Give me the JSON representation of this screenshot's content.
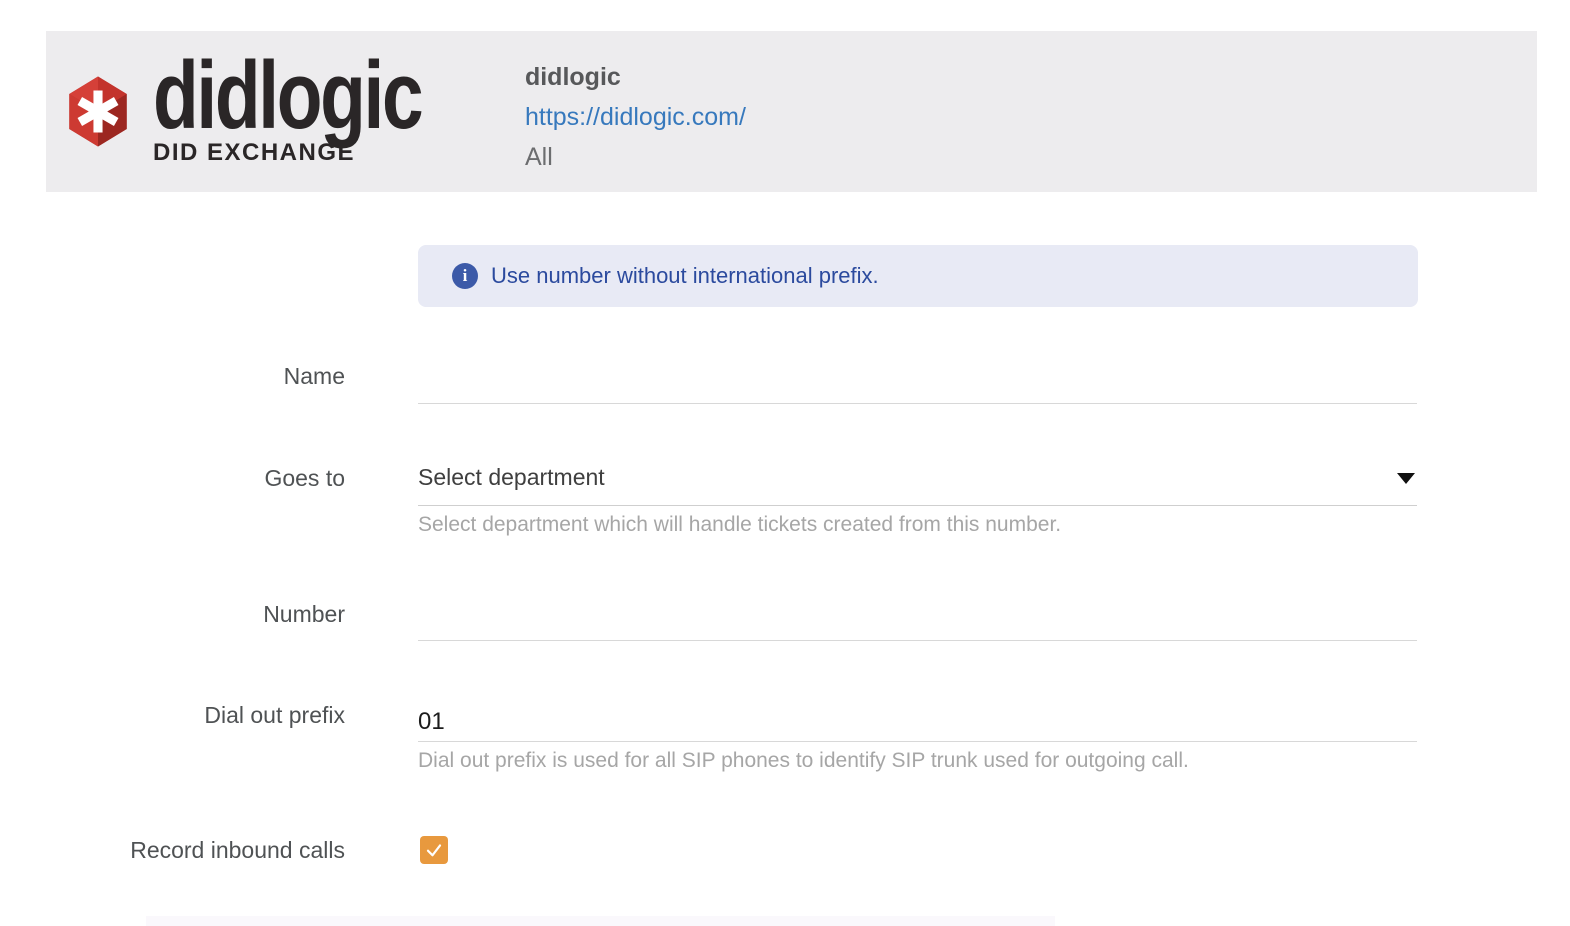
{
  "header": {
    "logo": {
      "wordmark": "didlogic",
      "tagline": "DID EXCHANGE"
    },
    "site": {
      "name": "didlogic",
      "url": "https://didlogic.com/",
      "scope": "All"
    }
  },
  "banner": {
    "icon": "info-icon",
    "icon_glyph": "i",
    "text": "Use number without international prefix."
  },
  "form": {
    "name": {
      "label": "Name",
      "value": ""
    },
    "goes_to": {
      "label": "Goes to",
      "value": "Select department",
      "helper": "Select department which will handle tickets created from this number."
    },
    "number": {
      "label": "Number",
      "value": ""
    },
    "dial_out_prefix": {
      "label": "Dial out prefix",
      "value": "01",
      "helper": "Dial out prefix is used for all SIP phones to identify SIP trunk used for outgoing call."
    },
    "record_inbound_calls": {
      "label": "Record inbound calls",
      "checked": true
    }
  },
  "colors": {
    "header_bg": "#edecee",
    "brand_red": "#cd3a32",
    "link_blue": "#3779bd",
    "banner_bg": "#e8eaf5",
    "banner_text": "#2b4a9e",
    "banner_icon_bg": "#3c5aa8",
    "checkbox_orange": "#e8993e",
    "label_gray": "#4f5254",
    "helper_gray": "#a6a6a6",
    "underline_gray": "#d8d8d8"
  }
}
